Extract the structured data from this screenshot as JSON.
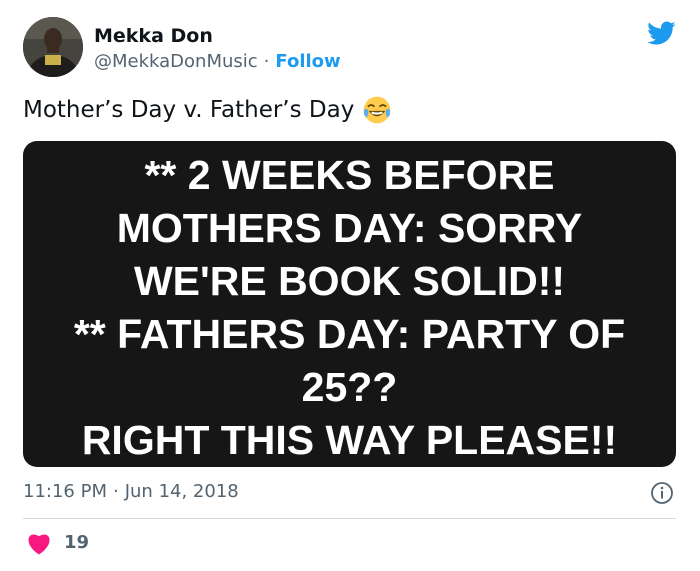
{
  "author": {
    "name": "Mekka Don",
    "handle": "@MekkaDonMusic",
    "separator": "·",
    "follow_label": "Follow"
  },
  "tweet": {
    "text": "Mother’s Day v. Father’s Day",
    "emoji": "face-with-tears-of-joy"
  },
  "media": {
    "lines": [
      "** 2 WEEKS BEFORE",
      "MOTHERS DAY: SORRY",
      "WE'RE BOOK SOLID!!",
      "** FATHERS DAY: PARTY OF",
      "25??",
      "RIGHT THIS WAY PLEASE!!"
    ]
  },
  "meta": {
    "time": "11:16 PM",
    "separator": "·",
    "date": "Jun 14, 2018"
  },
  "engagement": {
    "likes": "19"
  },
  "icons": {
    "brand": "twitter-bird-icon",
    "info": "info-icon",
    "like": "heart-icon"
  },
  "colors": {
    "brand": "#1d9bf0",
    "like": "#f91880",
    "media_bg": "#161616",
    "secondary_text": "#536471"
  }
}
